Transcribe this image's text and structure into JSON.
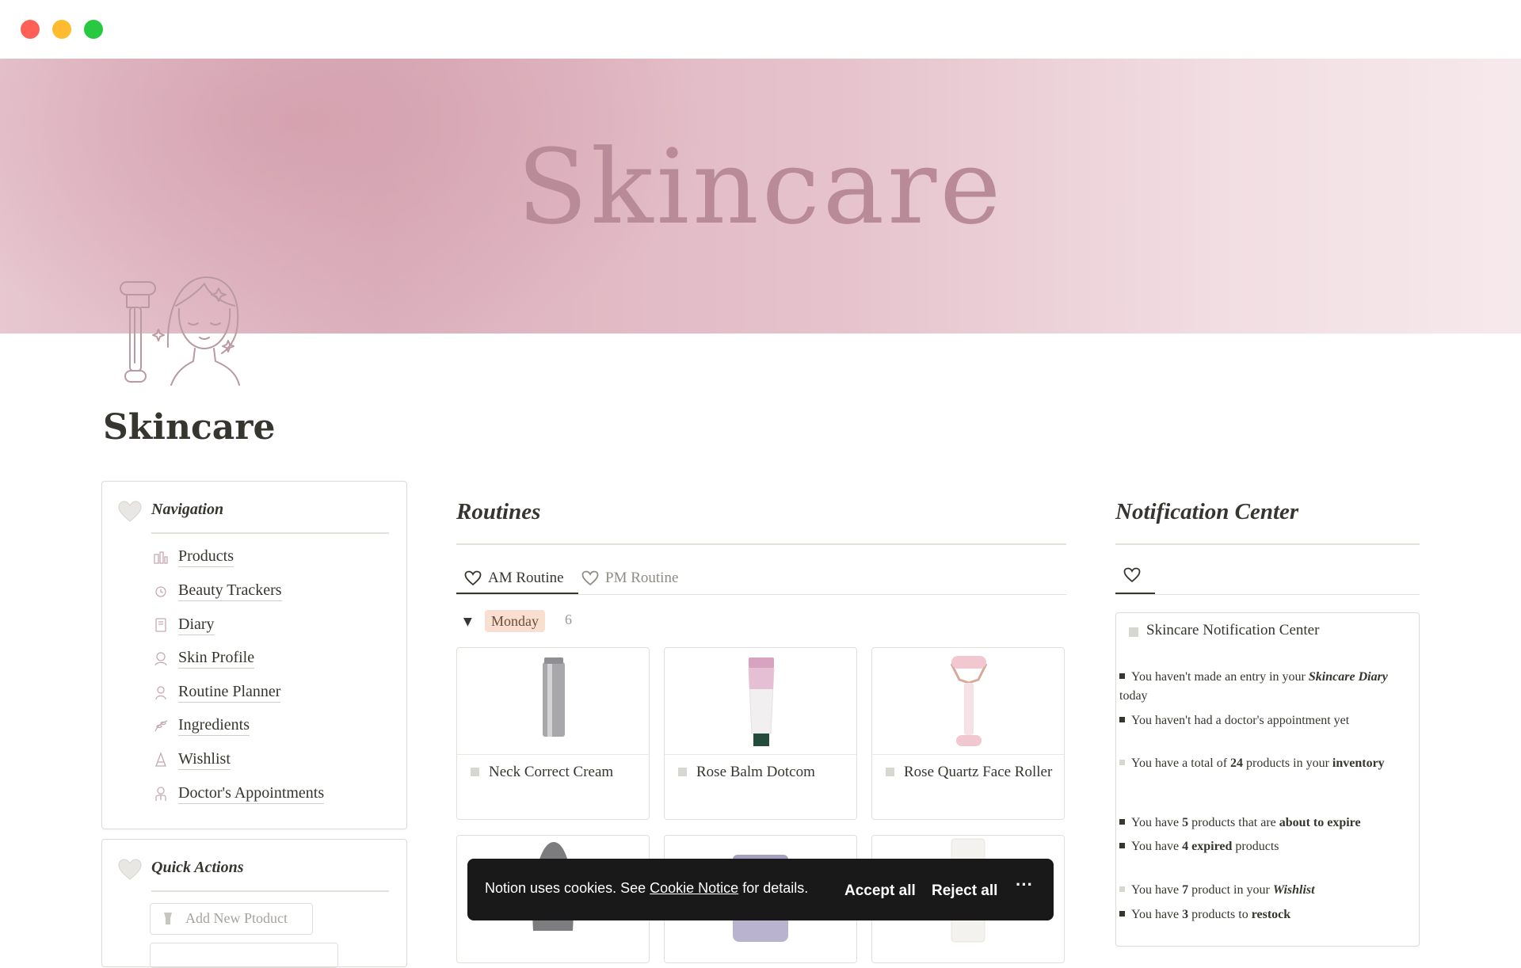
{
  "cover": {
    "title": "Skincare"
  },
  "page": {
    "title": "Skincare"
  },
  "navigation": {
    "heading": "Navigation",
    "items": [
      {
        "label": "Products",
        "icon": "products-icon"
      },
      {
        "label": "Beauty Trackers",
        "icon": "tracker-icon"
      },
      {
        "label": "Diary",
        "icon": "diary-icon"
      },
      {
        "label": "Skin Profile",
        "icon": "profile-icon"
      },
      {
        "label": "Routine Planner",
        "icon": "planner-icon"
      },
      {
        "label": "Ingredients",
        "icon": "ingredients-icon"
      },
      {
        "label": "Wishlist",
        "icon": "wishlist-icon"
      },
      {
        "label": "Doctor's Appointments",
        "icon": "doctor-icon"
      }
    ]
  },
  "quick_actions": {
    "heading": "Quick Actions",
    "add_product": "Add New Ptoduct"
  },
  "routines": {
    "heading": "Routines",
    "tabs": [
      {
        "label": "AM Routine"
      },
      {
        "label": "PM Routine"
      }
    ],
    "group": {
      "label": "Monday",
      "count": "6"
    },
    "products": [
      {
        "name": "Neck Correct Cream"
      },
      {
        "name": "Rose Balm Dotcom"
      },
      {
        "name": "Rose Quartz Face Roller"
      }
    ]
  },
  "notifications": {
    "heading": "Notification Center",
    "card_title": "Skincare Notification Center",
    "diary_pre": "You haven't made an entry in your ",
    "diary_em": "Skincare Diary",
    "diary_post": " today",
    "doctor": "You haven't had a doctor's appointment yet",
    "total_pre": "You have a total of ",
    "total_num": "24",
    "total_mid": " products in your ",
    "total_em": "inventory",
    "expire_pre": "You have ",
    "expire_num": "5",
    "expire_mid": " products that are ",
    "expire_em": "about to expire",
    "expired_pre": "You have ",
    "expired_em": "4 expired",
    "expired_post": " products",
    "wish_pre": "You have ",
    "wish_num": "7",
    "wish_mid": " product in your ",
    "wish_em": "Wishlist",
    "restock_pre": "You have ",
    "restock_num": "3",
    "restock_mid": " products to ",
    "restock_em": "restock"
  },
  "cookie": {
    "message_pre": "Notion uses cookies. See ",
    "link": "Cookie Notice",
    "message_post": " for details.",
    "accept": "Accept all",
    "reject": "Reject all",
    "more": "···"
  },
  "colors": {
    "tag_monday": "#f8dfcf",
    "cover_text": "#b98a98",
    "toast_bg": "#191919"
  }
}
